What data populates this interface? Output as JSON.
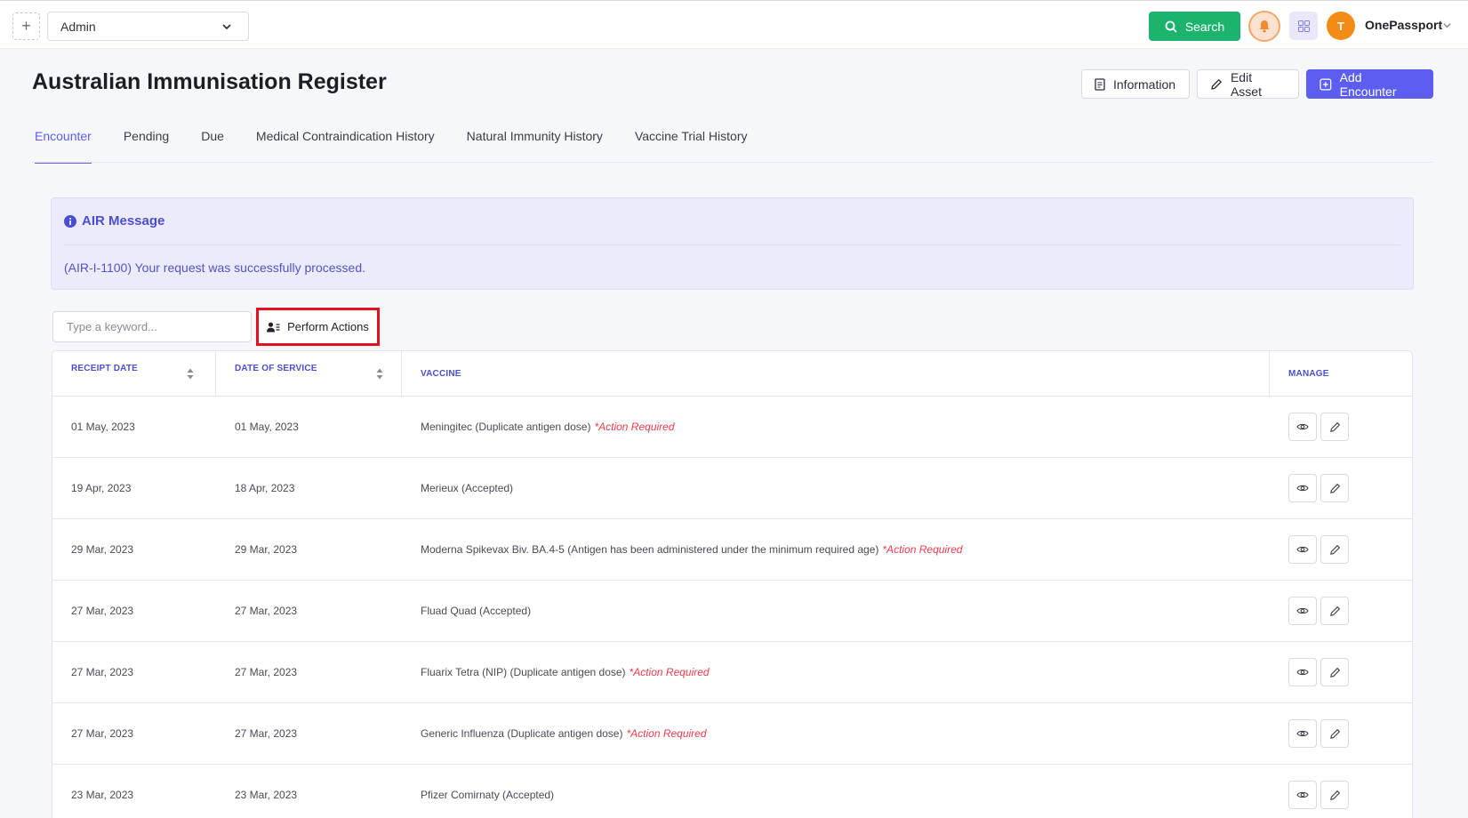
{
  "topbar": {
    "add_symbol": "+",
    "workspace_select": "Admin",
    "search_label": "Search",
    "avatar_initial": "T",
    "user_name": "OnePassport"
  },
  "header": {
    "title": "Australian Immunisation Register",
    "buttons": {
      "information": "Information",
      "edit_asset": "Edit Asset",
      "add_encounter": "Add Encounter"
    }
  },
  "tabs": [
    {
      "label": "Encounter",
      "active": true
    },
    {
      "label": "Pending"
    },
    {
      "label": "Due"
    },
    {
      "label": "Medical Contraindication History"
    },
    {
      "label": "Natural Immunity History"
    },
    {
      "label": "Vaccine Trial History"
    }
  ],
  "alert": {
    "title": "AIR Message",
    "message": "(AIR-I-1100) Your request was successfully processed."
  },
  "toolbar": {
    "search_placeholder": "Type a keyword...",
    "perform_actions": "Perform Actions"
  },
  "table": {
    "columns": {
      "receipt_date": "RECEIPT DATE",
      "date_of_service": "DATE OF SERVICE",
      "vaccine": "VACCINE",
      "manage": "MANAGE"
    },
    "rows": [
      {
        "receipt_date": "01 May, 2023",
        "date_of_service": "01 May, 2023",
        "vaccine": "Meningitec (Duplicate antigen dose)",
        "flag": "*Action Required"
      },
      {
        "receipt_date": "19 Apr, 2023",
        "date_of_service": "18 Apr, 2023",
        "vaccine": "Merieux (Accepted)",
        "flag": ""
      },
      {
        "receipt_date": "29 Mar, 2023",
        "date_of_service": "29 Mar, 2023",
        "vaccine": "Moderna Spikevax Biv. BA.4-5 (Antigen has been administered under the minimum required age)",
        "flag": "*Action Required"
      },
      {
        "receipt_date": "27 Mar, 2023",
        "date_of_service": "27 Mar, 2023",
        "vaccine": "Fluad Quad (Accepted)",
        "flag": ""
      },
      {
        "receipt_date": "27 Mar, 2023",
        "date_of_service": "27 Mar, 2023",
        "vaccine": "Fluarix Tetra (NIP) (Duplicate antigen dose)",
        "flag": "*Action Required"
      },
      {
        "receipt_date": "27 Mar, 2023",
        "date_of_service": "27 Mar, 2023",
        "vaccine": "Generic Influenza (Duplicate antigen dose)",
        "flag": "*Action Required"
      },
      {
        "receipt_date": "23 Mar, 2023",
        "date_of_service": "23 Mar, 2023",
        "vaccine": "Pfizer Comirnaty (Accepted)",
        "flag": ""
      }
    ]
  },
  "colors": {
    "accent": "#5b5ef0",
    "search_green": "#1cb36f",
    "avatar_orange": "#f28c16",
    "required_red": "#ef3b4a",
    "highlight_border": "#e5101e"
  },
  "icons": [
    "plus-icon",
    "chevron-down-icon",
    "search-icon",
    "bell-icon",
    "apps-grid-icon",
    "document-icon",
    "pencil-icon",
    "add-square-icon",
    "info-circle-icon",
    "user-list-icon",
    "sort-icon",
    "eye-icon"
  ]
}
